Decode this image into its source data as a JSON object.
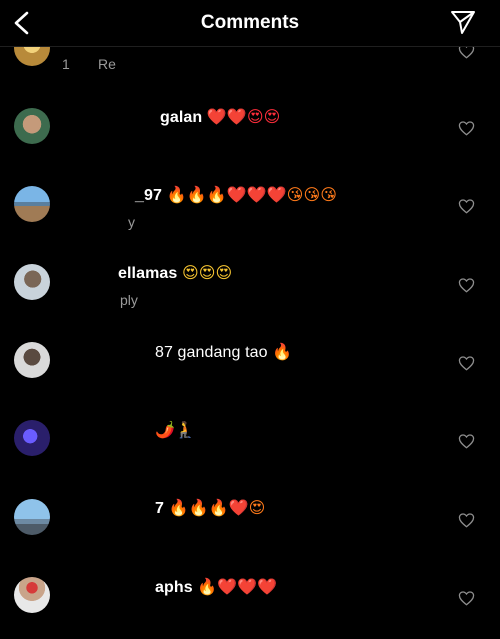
{
  "header": {
    "title": "Comments"
  },
  "partial_row": {
    "meta_count": "1",
    "meta_reply": "Re"
  },
  "comments": [
    {
      "text": "galan",
      "emojis": "❤️❤️😍😍"
    },
    {
      "text": "_97",
      "emojis": "🔥🔥🔥❤️❤️❤️😘😘😘",
      "meta": "y"
    },
    {
      "text": "ellamas",
      "emojis": "😍😍😍",
      "meta": "ply"
    },
    {
      "text": "87 gandang tao",
      "emojis": "🔥"
    },
    {
      "text": "",
      "emojis": "🌶️🧎"
    },
    {
      "text": "7",
      "emojis": "🔥🔥🔥❤️😍"
    },
    {
      "text": "aphs",
      "emojis": "🔥❤️❤️❤️"
    }
  ],
  "icons": {
    "back": "chevron-left-icon",
    "send": "paper-plane-icon",
    "like": "heart-outline-icon"
  },
  "colors": {
    "background": "#000000",
    "text": "#ffffff",
    "meta": "#9a9a9a",
    "heart": "#ff2d3b"
  }
}
